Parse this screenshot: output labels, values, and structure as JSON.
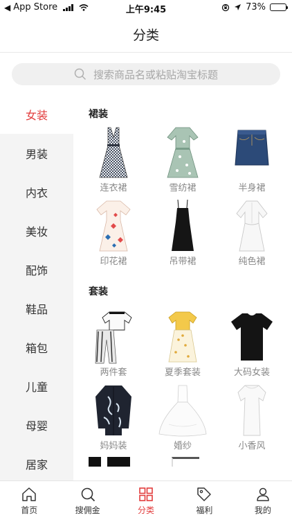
{
  "status_bar": {
    "back_label": "App Store",
    "time": "上午9:45",
    "battery": "73%",
    "battery_level": 0.73
  },
  "header": {
    "title": "分类"
  },
  "search": {
    "placeholder": "搜索商品名或粘贴淘宝标题"
  },
  "sidebar": {
    "items": [
      {
        "label": "女装",
        "active": true
      },
      {
        "label": "男装"
      },
      {
        "label": "内衣"
      },
      {
        "label": "美妆"
      },
      {
        "label": "配饰"
      },
      {
        "label": "鞋品"
      },
      {
        "label": "箱包"
      },
      {
        "label": "儿童"
      },
      {
        "label": "母婴"
      },
      {
        "label": "居家"
      }
    ]
  },
  "sections": [
    {
      "title": "裙装",
      "items": [
        {
          "label": "连衣裙",
          "icon": "plaid-dress-icon"
        },
        {
          "label": "雪纺裙",
          "icon": "chiffon-dress-icon"
        },
        {
          "label": "半身裙",
          "icon": "denim-skirt-icon"
        },
        {
          "label": "印花裙",
          "icon": "print-dress-icon"
        },
        {
          "label": "吊带裙",
          "icon": "slip-dress-icon"
        },
        {
          "label": "纯色裙",
          "icon": "solid-dress-icon"
        }
      ]
    },
    {
      "title": "套装",
      "items": [
        {
          "label": "两件套",
          "icon": "two-piece-icon"
        },
        {
          "label": "夏季套装",
          "icon": "summer-set-icon"
        },
        {
          "label": "大码女装",
          "icon": "plus-size-tee-icon"
        },
        {
          "label": "妈妈装",
          "icon": "mom-cardigan-icon"
        },
        {
          "label": "婚纱",
          "icon": "wedding-gown-icon"
        },
        {
          "label": "小香风",
          "icon": "chanel-style-dress-icon"
        }
      ]
    }
  ],
  "tab_bar": {
    "tabs": [
      {
        "label": "首页",
        "icon": "home-icon"
      },
      {
        "label": "搜佣金",
        "icon": "search-icon"
      },
      {
        "label": "分类",
        "icon": "category-grid-icon",
        "active": true
      },
      {
        "label": "福利",
        "icon": "tag-icon"
      },
      {
        "label": "我的",
        "icon": "user-icon"
      }
    ]
  },
  "colors": {
    "accent": "#e23c3c",
    "sidebar_bg": "#f4f4f4"
  }
}
